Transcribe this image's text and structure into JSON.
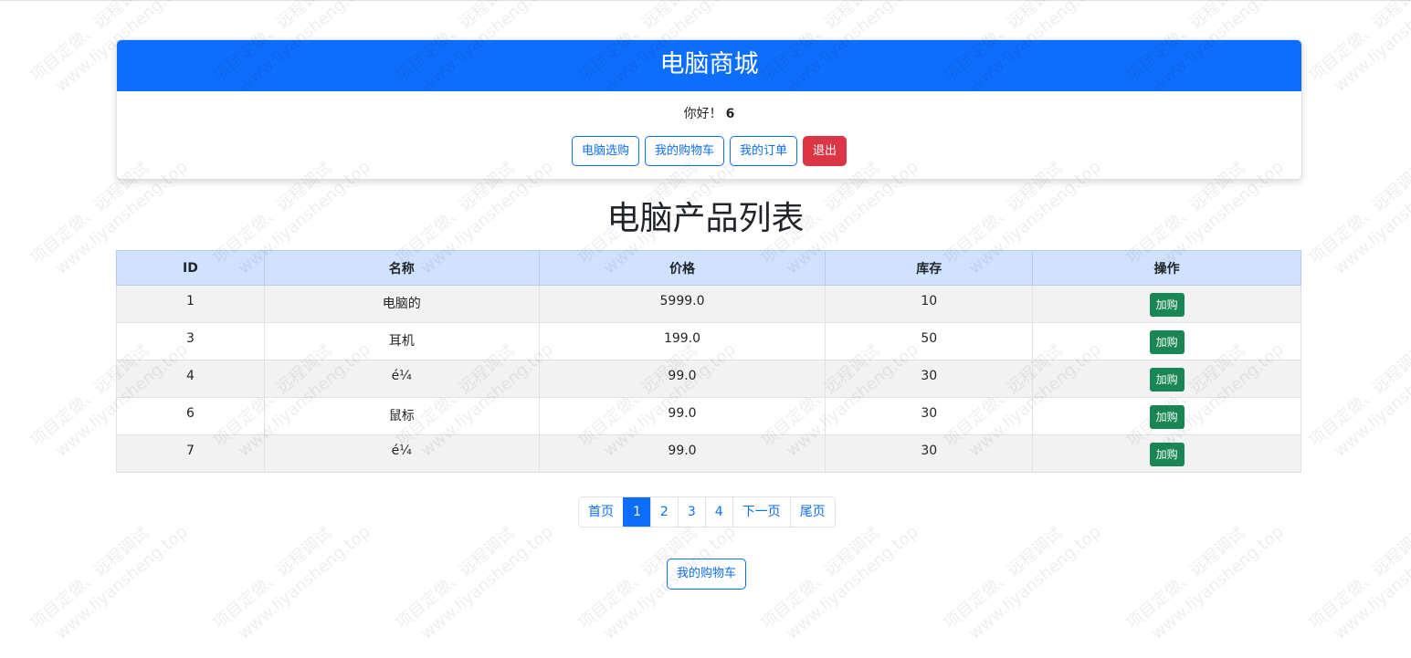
{
  "header": {
    "title": "电脑商城",
    "greeting_prefix": "你好！",
    "username": "6"
  },
  "nav": {
    "items": [
      {
        "label": "电脑选购",
        "style": "outline-primary"
      },
      {
        "label": "我的购物车",
        "style": "outline-primary"
      },
      {
        "label": "我的订单",
        "style": "outline-primary"
      },
      {
        "label": "退出",
        "style": "danger"
      }
    ]
  },
  "list": {
    "title": "电脑产品列表",
    "columns": [
      "ID",
      "名称",
      "价格",
      "库存",
      "操作"
    ],
    "rows": [
      {
        "id": "1",
        "name": "电脑的",
        "price": "5999.0",
        "stock": "10",
        "action": "加购"
      },
      {
        "id": "3",
        "name": "耳机",
        "price": "199.0",
        "stock": "50",
        "action": "加购"
      },
      {
        "id": "4",
        "name": "é¼",
        "price": "99.0",
        "stock": "30",
        "action": "加购"
      },
      {
        "id": "6",
        "name": "鼠标",
        "price": "99.0",
        "stock": "30",
        "action": "加购"
      },
      {
        "id": "7",
        "name": "é¼",
        "price": "99.0",
        "stock": "30",
        "action": "加购"
      }
    ]
  },
  "pagination": {
    "first": "首页",
    "pages": [
      "1",
      "2",
      "3",
      "4"
    ],
    "current": "1",
    "next": "下一页",
    "last": "尾页"
  },
  "footer": {
    "cart_button": "我的购物车"
  },
  "watermark": {
    "line1": "项目定做、远程调试",
    "line2": "www.liyansheng.top"
  },
  "colors": {
    "primary": "#0d6efd",
    "danger": "#dc3545",
    "success": "#198754",
    "table_header": "#cfe2ff"
  }
}
